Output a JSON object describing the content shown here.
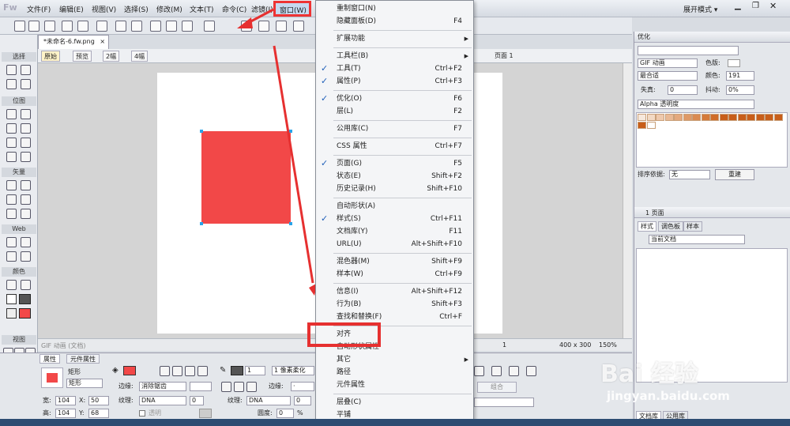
{
  "app": {
    "logo": "Fw",
    "workspace": "展开模式 ▾"
  },
  "menubar": [
    "文件(F)",
    "编辑(E)",
    "视图(V)",
    "选择(S)",
    "修改(M)",
    "文本(T)",
    "命令(C)",
    "滤镜(I)",
    "窗口(W)"
  ],
  "document": {
    "tab_title": "*未命名-6.fw.png",
    "views": [
      "原始",
      "预览",
      "2幅",
      "4幅"
    ],
    "page_label": "页面 1",
    "status_left": "GIF 动画 (文档)",
    "page_nav": "1",
    "size": "400 x 300",
    "zoom": "150%"
  },
  "tools": {
    "sections": [
      "选择",
      "位图",
      "矢量",
      "Web",
      "颜色",
      "视图"
    ]
  },
  "window_menu": {
    "items": [
      {
        "label": "重制窗口(N)",
        "shortcut": "",
        "checked": false,
        "submenu": false
      },
      {
        "label": "隐藏面板(D)",
        "shortcut": "F4",
        "checked": false,
        "submenu": false
      },
      {
        "label": "扩展功能",
        "shortcut": "",
        "checked": false,
        "submenu": true
      },
      {
        "label": "工具栏(B)",
        "shortcut": "",
        "checked": false,
        "submenu": true
      },
      {
        "label": "工具(T)",
        "shortcut": "Ctrl+F2",
        "checked": true,
        "submenu": false
      },
      {
        "label": "属性(P)",
        "shortcut": "Ctrl+F3",
        "checked": true,
        "submenu": false
      },
      {
        "label": "优化(O)",
        "shortcut": "F6",
        "checked": true,
        "submenu": false
      },
      {
        "label": "层(L)",
        "shortcut": "F2",
        "checked": false,
        "submenu": false
      },
      {
        "label": "公用库(C)",
        "shortcut": "F7",
        "checked": false,
        "submenu": false
      },
      {
        "label": "CSS 属性",
        "shortcut": "Ctrl+F7",
        "checked": false,
        "submenu": false
      },
      {
        "label": "页面(G)",
        "shortcut": "F5",
        "checked": true,
        "submenu": false
      },
      {
        "label": "状态(E)",
        "shortcut": "Shift+F2",
        "checked": false,
        "submenu": false
      },
      {
        "label": "历史记录(H)",
        "shortcut": "Shift+F10",
        "checked": false,
        "submenu": false
      },
      {
        "label": "自动形状(A)",
        "shortcut": "",
        "checked": false,
        "submenu": false
      },
      {
        "label": "样式(S)",
        "shortcut": "Ctrl+F11",
        "checked": true,
        "submenu": false
      },
      {
        "label": "文档库(Y)",
        "shortcut": "F11",
        "checked": false,
        "submenu": false
      },
      {
        "label": "URL(U)",
        "shortcut": "Alt+Shift+F10",
        "checked": false,
        "submenu": false
      },
      {
        "label": "混色器(M)",
        "shortcut": "Shift+F9",
        "checked": false,
        "submenu": false
      },
      {
        "label": "样本(W)",
        "shortcut": "Ctrl+F9",
        "checked": false,
        "submenu": false
      },
      {
        "label": "信息(I)",
        "shortcut": "Alt+Shift+F12",
        "checked": false,
        "submenu": false
      },
      {
        "label": "行为(B)",
        "shortcut": "Shift+F3",
        "checked": false,
        "submenu": false
      },
      {
        "label": "查找和替换(F)",
        "shortcut": "Ctrl+F",
        "checked": false,
        "submenu": false
      },
      {
        "label": "对齐",
        "shortcut": "",
        "checked": false,
        "submenu": false
      },
      {
        "label": "自动形状属性",
        "shortcut": "",
        "checked": false,
        "submenu": false
      },
      {
        "label": "其它",
        "shortcut": "",
        "checked": false,
        "submenu": true
      },
      {
        "label": "路径",
        "shortcut": "",
        "checked": false,
        "submenu": false
      },
      {
        "label": "元件属性",
        "shortcut": "",
        "checked": false,
        "submenu": false
      },
      {
        "label": "层叠(C)",
        "shortcut": "",
        "checked": false,
        "submenu": false
      },
      {
        "label": "平铺",
        "shortcut": "",
        "checked": false,
        "submenu": false
      }
    ]
  },
  "properties": {
    "tabs": [
      "属性",
      "元件属性"
    ],
    "shape_type": "矩形",
    "name": "矩形",
    "width_label": "宽:",
    "width": "104",
    "height_label": "高:",
    "height": "104",
    "x_label": "X:",
    "x": "50",
    "y_label": "Y:",
    "y": "68",
    "edge_label": "边缘:",
    "edge_value": "消除锯齿",
    "texture_label": "纹理:",
    "texture_value": "DNA",
    "texture_pct": "0",
    "transparent_label": "透明",
    "stroke_size": "1",
    "stroke_type": "1 像素柔化",
    "stroke_edge_label": "边缘:",
    "stroke_edge_value": "·",
    "stroke_texture_label": "纹理:",
    "stroke_texture_value": "DNA",
    "stroke_texture_pct": "0",
    "roundness_label": "圆度:",
    "roundness": "0",
    "group_button": "组合"
  },
  "optimize": {
    "title": "优化",
    "format": "GIF 动画",
    "dither_label": "色版:",
    "palette": "最合适",
    "colors_label": "颜色:",
    "colors": "191",
    "loss_label": "失真:",
    "loss": "0",
    "dither2_label": "抖动:",
    "dither_pct": "0%",
    "transparency": "Alpha 透明度",
    "sort_label": "排序依据:",
    "sort_value": "无",
    "rebuild": "重建"
  },
  "pages_panel": {
    "item": "1  页面"
  },
  "styles_panel": {
    "tabs": [
      "样式",
      "调色板",
      "样本"
    ],
    "doc": "当前文档"
  },
  "bottom_tabs": [
    "文档库",
    "公用库"
  ],
  "watermark": {
    "main": "Bai 经验",
    "sub": "jingyan.baidu.com"
  },
  "colors": {
    "accent_red": "#e63030",
    "shape_fill": "#f24848",
    "menu_check": "#1f5fb8"
  }
}
